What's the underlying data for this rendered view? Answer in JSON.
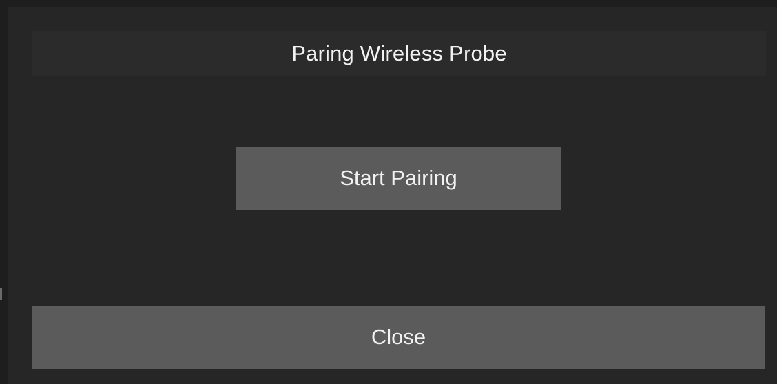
{
  "dialog": {
    "title": "Paring Wireless Probe",
    "start_button_label": "Start Pairing",
    "close_button_label": "Close"
  },
  "colors": {
    "background": "#1e1e1e",
    "dialog_background": "#262626",
    "header_background": "#2b2b2b",
    "button_background": "#5b5b5b",
    "text": "#f2f2f2"
  }
}
